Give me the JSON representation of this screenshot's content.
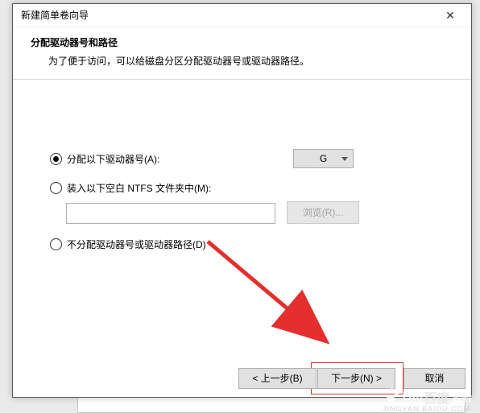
{
  "window": {
    "title": "新建简单卷向导",
    "close_glyph": "✕"
  },
  "header": {
    "title": "分配驱动器号和路径",
    "subtitle": "为了便于访问，可以给磁盘分区分配驱动器号或驱动器路径。"
  },
  "options": {
    "assign_letter": {
      "label": "分配以下驱动器号(A):",
      "selected": true,
      "drive_value": "G"
    },
    "mount_folder": {
      "label": "装入以下空白 NTFS 文件夹中(M):",
      "selected": false,
      "path_value": "",
      "browse_label": "浏览(R)..."
    },
    "no_assign": {
      "label": "不分配驱动器号或驱动器路径(D)",
      "selected": false
    }
  },
  "footer": {
    "back": "< 上一步(B)",
    "next": "下一步(N) >",
    "cancel": "取消"
  },
  "watermark": {
    "brand": "Bai",
    "brand2": "百度",
    "suffix": "经验",
    "sub": "JINGYAN.BAIDU.COM"
  }
}
